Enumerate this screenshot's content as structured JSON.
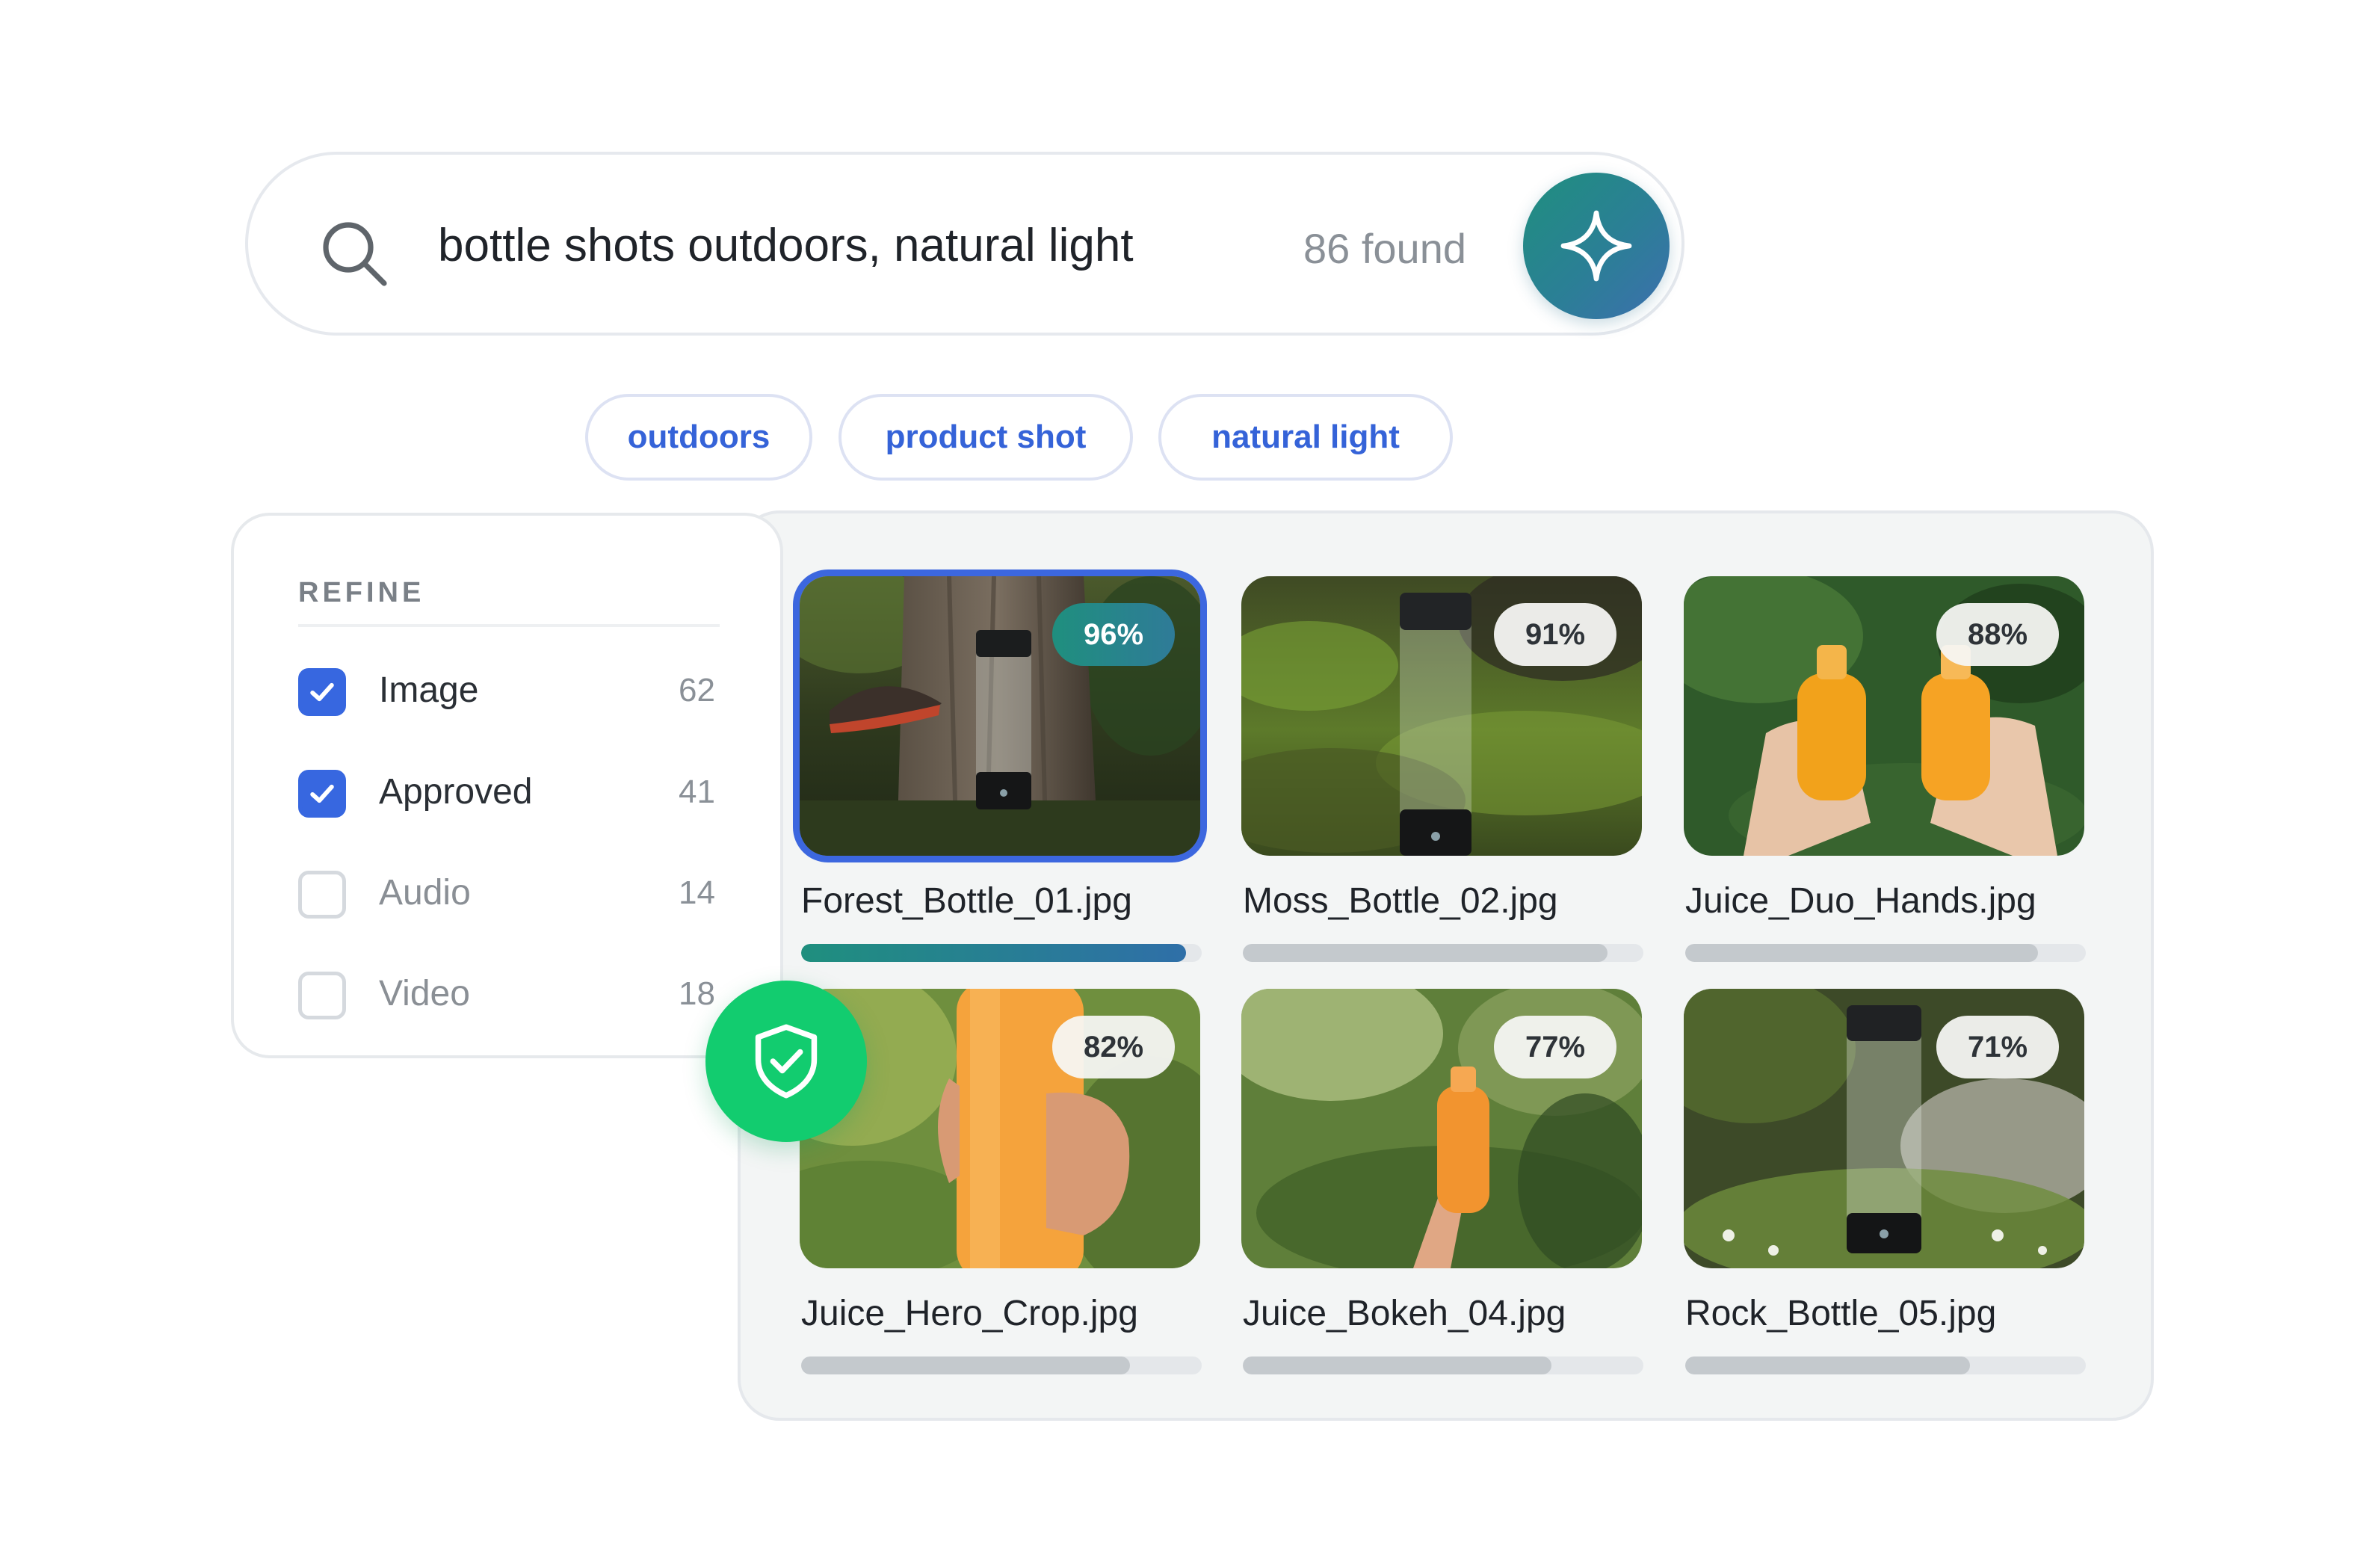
{
  "search": {
    "query": "bottle shots outdoors, natural light",
    "found": "86 found",
    "search_icon": "search-icon",
    "ai_button_icon": "sparkle-icon"
  },
  "chips": [
    {
      "label": "outdoors"
    },
    {
      "label": "product shot"
    },
    {
      "label": "natural light"
    }
  ],
  "refine": {
    "heading": "REFINE",
    "filters": [
      {
        "label": "Image",
        "count": "62",
        "checked": true
      },
      {
        "label": "Approved",
        "count": "41",
        "checked": true
      },
      {
        "label": "Audio",
        "count": "14",
        "checked": false
      },
      {
        "label": "Video",
        "count": "18",
        "checked": false
      }
    ]
  },
  "shield_icon": "shield-check-icon",
  "results": [
    {
      "file": "Forest_Bottle_01.jpg",
      "score": "96%",
      "match": 0.96,
      "selected": true
    },
    {
      "file": "Moss_Bottle_02.jpg",
      "score": "91%",
      "match": 0.91,
      "selected": false
    },
    {
      "file": "Juice_Duo_Hands.jpg",
      "score": "88%",
      "match": 0.88,
      "selected": false
    },
    {
      "file": "Juice_Hero_Crop.jpg",
      "score": "82%",
      "match": 0.82,
      "selected": false
    },
    {
      "file": "Juice_Bokeh_04.jpg",
      "score": "77%",
      "match": 0.77,
      "selected": false
    },
    {
      "file": "Rock_Bottle_05.jpg",
      "score": "71%",
      "match": 0.71,
      "selected": false
    }
  ],
  "colors": {
    "accent_blue": "#3767e0",
    "accent_teal": "#1f8f7e",
    "shield_green": "#12cc6f",
    "chip_text": "#3563d8"
  }
}
